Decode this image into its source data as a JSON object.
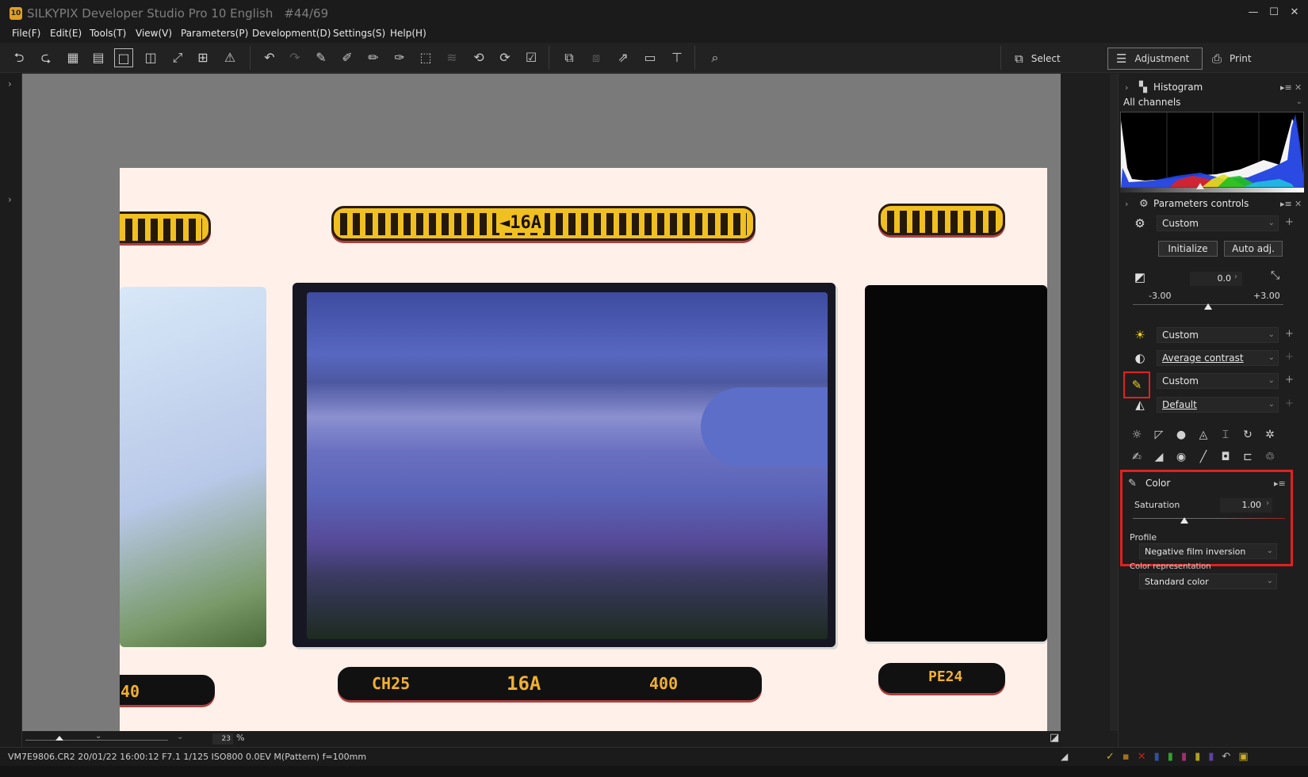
{
  "window": {
    "title": "SILKYPIX Developer Studio Pro 10 English",
    "count": "#44/69",
    "minimize": "—",
    "maximize": "☐",
    "close": "✕"
  },
  "menu": [
    "File(F)",
    "Edit(E)",
    "Tools(T)",
    "View(V)",
    "Parameters(P)",
    "Development(D)",
    "Settings(S)",
    "Help(H)"
  ],
  "modes": {
    "select": "Select",
    "adjustment": "Adjustment",
    "print": "Print"
  },
  "viewer": {
    "zoom_value": "23",
    "zoom_unit": "%",
    "film_top_label": "◄16A",
    "film_bottom_labels": [
      "CH25",
      "16A",
      "400",
      "40",
      "PE24"
    ]
  },
  "status": {
    "file_info": "VM7E9806.CR2 20/01/22 16:00:12 F7.1 1/125 ISO800  0.0EV M(Pattern) f=100mm"
  },
  "histogram": {
    "title": "Histogram",
    "channel": "All channels"
  },
  "parameters": {
    "title": "Parameters controls",
    "preset": "Custom",
    "initialize": "Initialize",
    "auto_adj": "Auto adj.",
    "exposure_value": "0.0",
    "exposure_min": "-3.00",
    "exposure_max": "+3.00",
    "exposure_level": 0.0,
    "white_balance": "Custom",
    "tone": "Average contrast",
    "color_preset": "Custom",
    "sharpness": "Default"
  },
  "color": {
    "title": "Color",
    "saturation_label": "Saturation",
    "saturation_value": "1.00",
    "profile_label": "Profile",
    "profile_value": "Negative film inversion",
    "representation_label": "Color representation",
    "representation_value": "Standard color"
  },
  "accent": {
    "highlight": "#e32020"
  }
}
